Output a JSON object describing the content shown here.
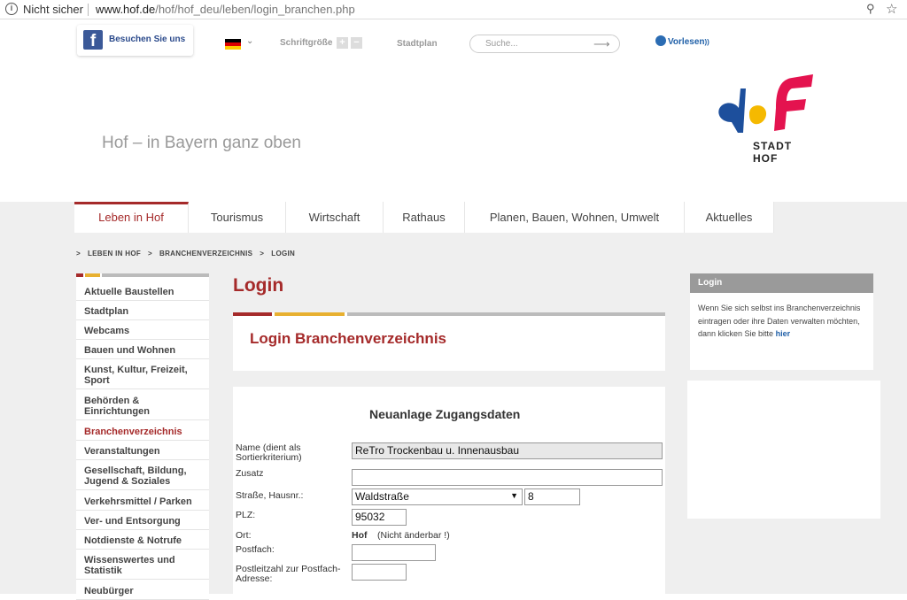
{
  "browser": {
    "security": "Nicht sicher",
    "url_host": "www.hof.de",
    "url_path": "/hof/hof_deu/leben/login_branchen.php"
  },
  "topbar": {
    "facebook": "Besuchen Sie uns",
    "font_size_label": "Schriftgröße",
    "font_plus": "+",
    "font_minus": "−",
    "stadtplan": "Stadtplan",
    "search_placeholder": "Suche...",
    "vorlesen": "Vorlesen"
  },
  "brand": {
    "tagline": "Hof – in Bayern ganz oben",
    "logo_text": "STADT HOF",
    "accent": "#a52a2a",
    "logo_red": "#e4134f",
    "logo_yellow": "#f5b900",
    "logo_blue": "#1d4f9c"
  },
  "nav": {
    "items": [
      "Leben in Hof",
      "Tourismus",
      "Wirtschaft",
      "Rathaus",
      "Planen, Bauen, Wohnen, Umwelt",
      "Aktuelles"
    ],
    "active": "Leben in Hof"
  },
  "breadcrumb": [
    ">",
    "LEBEN IN HOF",
    ">",
    "BRANCHENVERZEICHNIS",
    ">",
    "LOGIN"
  ],
  "sidebar": {
    "items": [
      "Aktuelle Baustellen",
      "Stadtplan",
      "Webcams",
      "Bauen und Wohnen",
      "Kunst, Kultur, Freizeit, Sport",
      "Behörden & Einrichtungen",
      "Branchenverzeichnis",
      "Veranstaltungen",
      "Gesellschaft, Bildung, Jugend & Soziales",
      "Verkehrsmittel / Parken",
      "Ver- und Entsorgung",
      "Notdienste & Notrufe",
      "Wissenswertes und Statistik",
      "Neubürger"
    ],
    "active": "Branchenverzeichnis"
  },
  "main": {
    "title": "Login",
    "panel_title": "Login Branchenverzeichnis"
  },
  "form": {
    "heading": "Neuanlage Zugangsdaten",
    "name_label": "Name   (dient als Sortierkriterium)",
    "name_value": "ReTro Trockenbau u. Innenausbau",
    "zusatz_label": "Zusatz",
    "zusatz_value": "",
    "strasse_label": "Straße, Hausnr.:",
    "strasse_value": "Waldstraße",
    "hausnr_value": "8",
    "plz_label": "PLZ:",
    "plz_value": "95032",
    "ort_label": "Ort:",
    "ort_value": "Hof",
    "ort_note": "(Nicht änderbar !)",
    "postfach_label": "Postfach:",
    "postfach_value": "",
    "postfach_plz_label": "Postleitzahl zur Postfach-Adresse:",
    "postfach_plz_value": ""
  },
  "right": {
    "box_title": "Login",
    "box_text": "Wenn Sie sich selbst ins Branchenverzeichnis eintragen oder ihre Daten verwalten möchten, dann klicken Sie bitte",
    "box_link": "hier"
  }
}
